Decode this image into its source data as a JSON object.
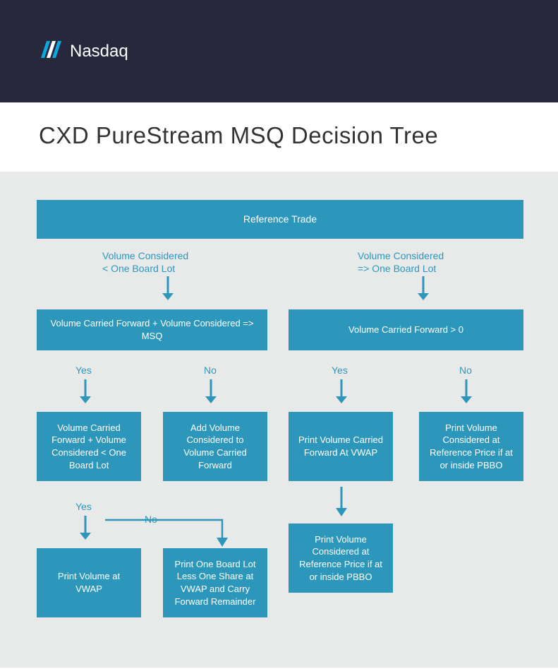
{
  "header": {
    "brand": "Nasdaq"
  },
  "title": "CXD PureStream MSQ Decision Tree",
  "boxes": {
    "root": "Reference Trade",
    "leftCond": "Volume Carried Forward + Volume Considered => MSQ",
    "rightCond": "Volume Carried Forward > 0",
    "l_yes": "Volume Carried Forward + Volume Considered < One Board Lot",
    "l_no": "Add Volume Considered to Volume Carried Forward",
    "r_yes": "Print Volume Carried Forward At VWAP",
    "r_no": "Print Volume Considered at Reference Price if at or inside PBBO",
    "ll_yes": "Print Volume at VWAP",
    "ll_no": "Print One Board Lot Less One Share at VWAP and Carry Forward Remainder",
    "r_yes_2": "Print Volume Considered at Reference Price if at or inside PBBO"
  },
  "labels": {
    "branchLeft": "Volume Considered\n< One Board Lot",
    "branchRight": "Volume Considered\n=> One Board Lot",
    "yes": "Yes",
    "no": "No"
  },
  "colors": {
    "teal": "#2d97bb",
    "headerBg": "#28283c",
    "canvasBg": "#e8e9e9"
  }
}
